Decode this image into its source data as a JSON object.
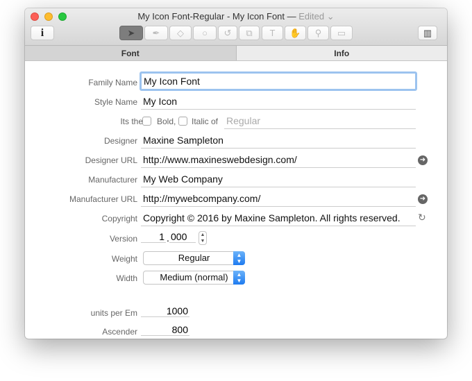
{
  "window": {
    "title": "My Icon Font-Regular - My Icon Font —",
    "edited": "Edited ⌄"
  },
  "toolbar": {
    "info": "i",
    "tools": [
      "select-tool",
      "pen-tool",
      "eraser-tool",
      "shape-tool",
      "rotate-tool",
      "transform-tool",
      "text-tool",
      "hand-tool",
      "zoom-tool",
      "measure-tool"
    ],
    "tool_glyphs": [
      "➤",
      "✒",
      "◇",
      "○",
      "↺",
      "⧉",
      "T",
      "✋",
      "⚲",
      "▭"
    ]
  },
  "tabs": [
    "Font",
    "Info"
  ],
  "form": {
    "family_name": {
      "label": "Family Name",
      "value": "My Icon Font"
    },
    "style_name": {
      "label": "Style Name",
      "value": "My Icon"
    },
    "style_link": {
      "label": "Its the",
      "bold": "Bold,",
      "italic": "Italic of",
      "placeholder": "Regular"
    },
    "designer": {
      "label": "Designer",
      "value": "Maxine Sampleton"
    },
    "designer_url": {
      "label": "Designer URL",
      "value": "http://www.maxineswebdesign.com/"
    },
    "manufacturer": {
      "label": "Manufacturer",
      "value": "My Web Company"
    },
    "manufacturer_url": {
      "label": "Manufacturer URL",
      "value": "http://mywebcompany.com/"
    },
    "copyright": {
      "label": "Copyright",
      "value": "Copyright © 2016 by Maxine Sampleton. All rights reserved."
    },
    "version": {
      "label": "Version",
      "major": "1",
      "minor": "000"
    },
    "weight": {
      "label": "Weight",
      "value": "Regular"
    },
    "width": {
      "label": "Width",
      "value": "Medium (normal)"
    },
    "units_per_em": {
      "label": "units per Em",
      "value": "1000"
    },
    "ascender": {
      "label": "Ascender",
      "value": "800"
    }
  }
}
